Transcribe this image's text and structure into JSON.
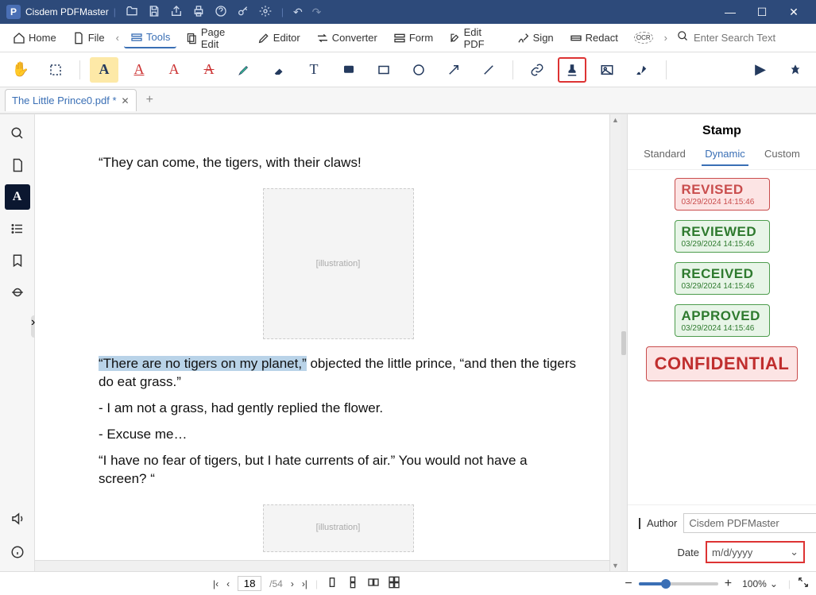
{
  "titlebar": {
    "app_name": "Cisdem PDFMaster"
  },
  "menubar": {
    "home": "Home",
    "file": "File",
    "tools": "Tools",
    "page_edit": "Page Edit",
    "editor": "Editor",
    "converter": "Converter",
    "form": "Form",
    "edit_pdf": "Edit PDF",
    "sign": "Sign",
    "redact": "Redact",
    "ocr": "OCR"
  },
  "search": {
    "placeholder": "Enter Search Text"
  },
  "tabs": {
    "doc_name": "The Little Prince0.pdf *"
  },
  "doc": {
    "p1": "“They can come, the tigers, with their claws!",
    "p2a": "“There are no tigers on my planet,”",
    "p2b": " objected the little prince, “and then the tigers do eat grass.”",
    "p3": "- I am not a grass, had gently replied the flower.",
    "p4": "- Excuse me…",
    "p5": "“I have no fear of tigers, but I hate currents of air.” You would not have a screen? “"
  },
  "right": {
    "title": "Stamp",
    "tab_standard": "Standard",
    "tab_dynamic": "Dynamic",
    "tab_custom": "Custom",
    "stamps": {
      "revised": "REVISED",
      "reviewed": "REVIEWED",
      "received": "RECEIVED",
      "approved": "APPROVED",
      "confidential": "CONFIDENTIAL",
      "ts": "03/29/2024 14:15:46"
    },
    "author_label": "Author",
    "author_value": "Cisdem PDFMaster",
    "date_label": "Date",
    "date_value": "m/d/yyyy"
  },
  "status": {
    "page": "18",
    "total": "/54",
    "zoom": "100%"
  }
}
